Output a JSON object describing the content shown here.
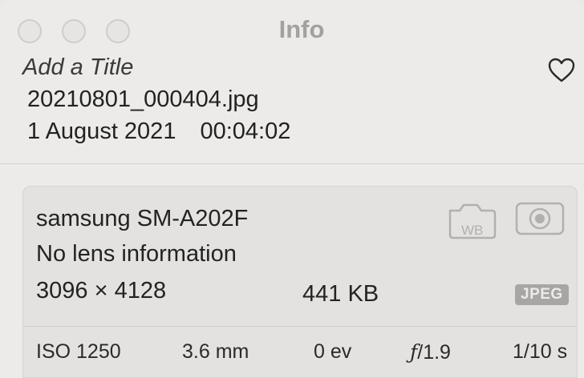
{
  "window": {
    "title": "Info"
  },
  "header": {
    "title_placeholder": "Add a Title",
    "filename": "20210801_000404.jpg",
    "date": "1 August 2021",
    "time": "00:04:02"
  },
  "details": {
    "camera": "samsung SM-A202F",
    "lens": "No lens information",
    "dimensions": "3096 × 4128",
    "file_size": "441 KB",
    "format_badge": "JPEG",
    "exif": {
      "iso": "ISO 1250",
      "focal_length": "3.6 mm",
      "exposure_bias": "0 ev",
      "aperture_symbol": "ƒ",
      "aperture_value": "/1.9",
      "shutter_speed": "1/10 s"
    },
    "icons": [
      "camera-wb-icon",
      "metering-icon"
    ]
  },
  "colors": {
    "background": "#ecebe9",
    "card": "#e3e2e0",
    "badge": "#a8a6a4"
  }
}
